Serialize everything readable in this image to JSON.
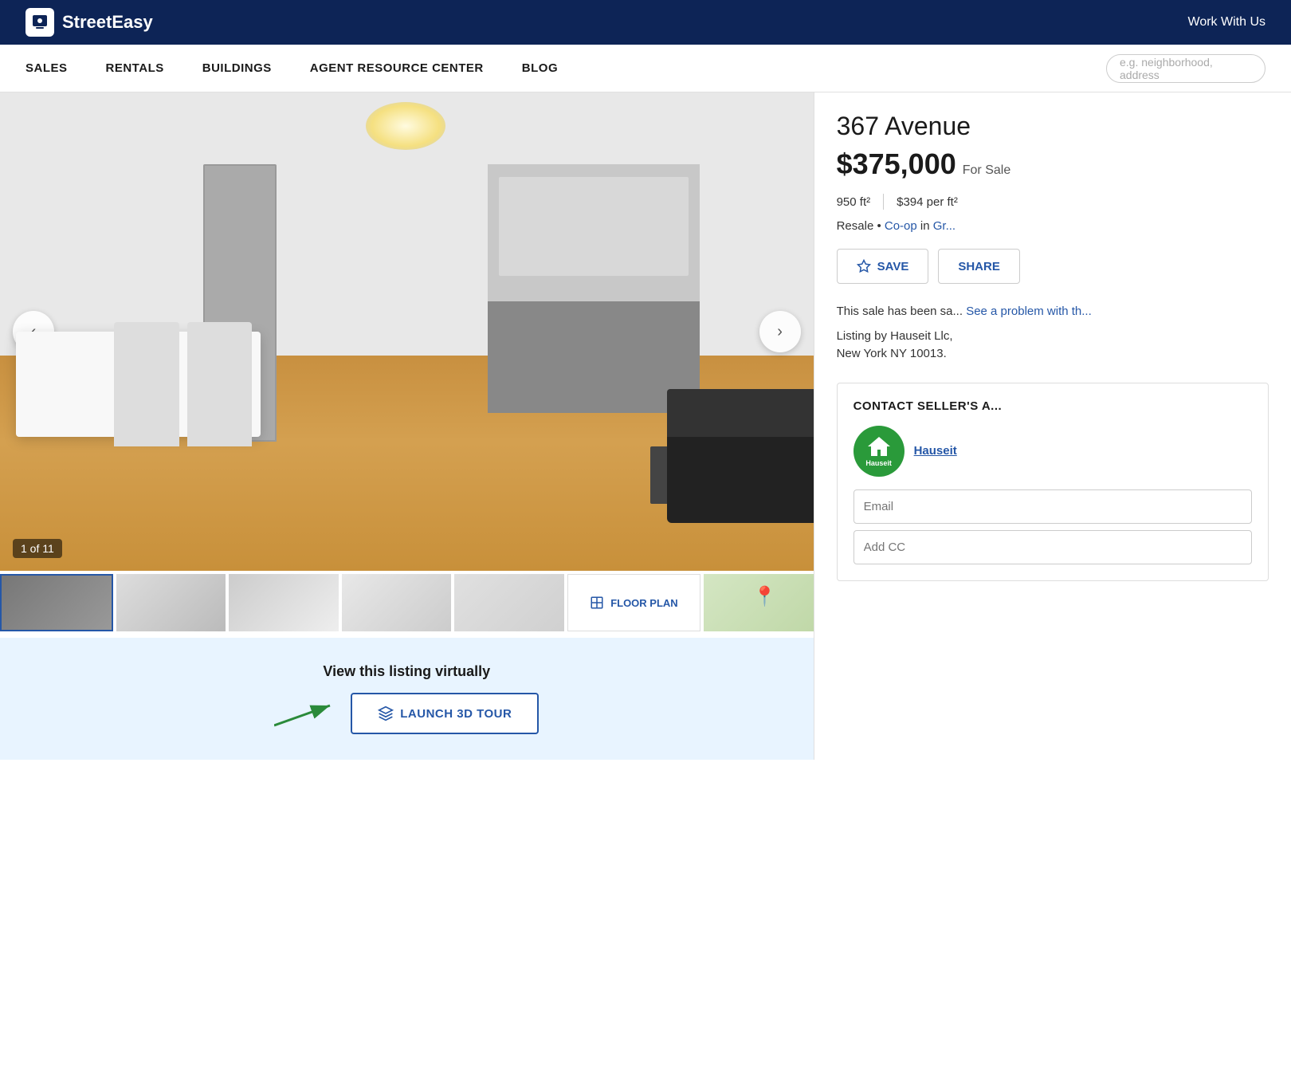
{
  "header": {
    "logo_text": "StreetEasy",
    "work_with_us": "Work With Us"
  },
  "nav": {
    "items": [
      {
        "id": "sales",
        "label": "SALES"
      },
      {
        "id": "rentals",
        "label": "RENTALS"
      },
      {
        "id": "buildings",
        "label": "BUILDINGS"
      },
      {
        "id": "agent-resource-center",
        "label": "AGENT RESOURCE CENTER"
      },
      {
        "id": "blog",
        "label": "BLOG"
      }
    ],
    "search_placeholder": "e.g. neighborhood, address"
  },
  "listing": {
    "address": "367 Avenue",
    "price": "$375,000",
    "price_label": "For Sale",
    "sqft": "950 ft²",
    "price_per_sqft": "$394 per ft²",
    "type_text": "Resale • ",
    "type_link": "Co-op",
    "type_location_link": "Gr...",
    "save_label": "SAVE",
    "share_label": "SHARE",
    "sale_notice": "This sale has been sa... See a problem with th...",
    "listing_by": "Listing by Hauseit Llc,\nNew York NY 10013.",
    "image_counter": "1 of 11"
  },
  "gallery": {
    "thumbnails": [
      {
        "id": "thumb-1",
        "label": "Interior 1"
      },
      {
        "id": "thumb-2",
        "label": "Interior 2"
      },
      {
        "id": "thumb-3",
        "label": "Interior 3"
      },
      {
        "id": "thumb-4",
        "label": "Interior 4"
      },
      {
        "id": "thumb-5",
        "label": "Interior 5"
      }
    ],
    "floor_plan_label": "FLOOR PLAN",
    "map_label": "Map"
  },
  "virtual_tour": {
    "title": "View this listing virtually",
    "button_label": "LAUNCH 3D TOUR"
  },
  "contact": {
    "title": "CONTACT SELLER'S A...",
    "agent_company": "Hauseit",
    "agent_logo_top": "🏠",
    "agent_logo_text": "Hauseit",
    "email_placeholder": "Email",
    "cc_placeholder": "Add CC"
  }
}
